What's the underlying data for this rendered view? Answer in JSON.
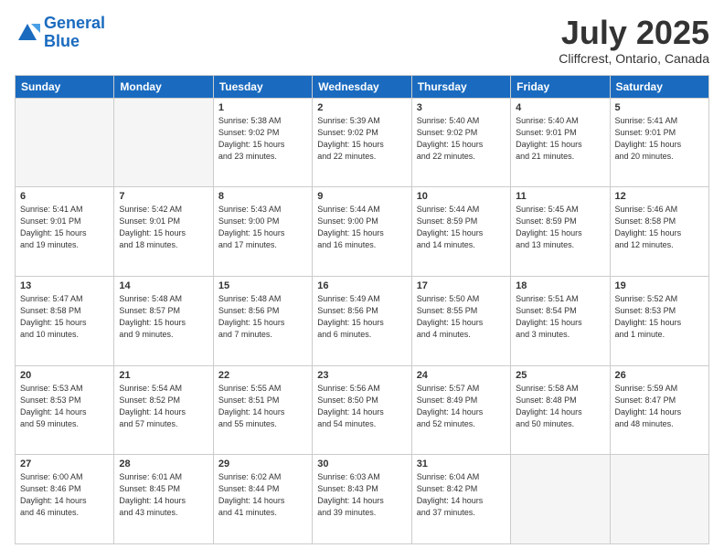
{
  "header": {
    "logo_line1": "General",
    "logo_line2": "Blue",
    "month": "July 2025",
    "location": "Cliffcrest, Ontario, Canada"
  },
  "weekdays": [
    "Sunday",
    "Monday",
    "Tuesday",
    "Wednesday",
    "Thursday",
    "Friday",
    "Saturday"
  ],
  "weeks": [
    [
      {
        "day": "",
        "info": ""
      },
      {
        "day": "",
        "info": ""
      },
      {
        "day": "1",
        "info": "Sunrise: 5:38 AM\nSunset: 9:02 PM\nDaylight: 15 hours\nand 23 minutes."
      },
      {
        "day": "2",
        "info": "Sunrise: 5:39 AM\nSunset: 9:02 PM\nDaylight: 15 hours\nand 22 minutes."
      },
      {
        "day": "3",
        "info": "Sunrise: 5:40 AM\nSunset: 9:02 PM\nDaylight: 15 hours\nand 22 minutes."
      },
      {
        "day": "4",
        "info": "Sunrise: 5:40 AM\nSunset: 9:01 PM\nDaylight: 15 hours\nand 21 minutes."
      },
      {
        "day": "5",
        "info": "Sunrise: 5:41 AM\nSunset: 9:01 PM\nDaylight: 15 hours\nand 20 minutes."
      }
    ],
    [
      {
        "day": "6",
        "info": "Sunrise: 5:41 AM\nSunset: 9:01 PM\nDaylight: 15 hours\nand 19 minutes."
      },
      {
        "day": "7",
        "info": "Sunrise: 5:42 AM\nSunset: 9:01 PM\nDaylight: 15 hours\nand 18 minutes."
      },
      {
        "day": "8",
        "info": "Sunrise: 5:43 AM\nSunset: 9:00 PM\nDaylight: 15 hours\nand 17 minutes."
      },
      {
        "day": "9",
        "info": "Sunrise: 5:44 AM\nSunset: 9:00 PM\nDaylight: 15 hours\nand 16 minutes."
      },
      {
        "day": "10",
        "info": "Sunrise: 5:44 AM\nSunset: 8:59 PM\nDaylight: 15 hours\nand 14 minutes."
      },
      {
        "day": "11",
        "info": "Sunrise: 5:45 AM\nSunset: 8:59 PM\nDaylight: 15 hours\nand 13 minutes."
      },
      {
        "day": "12",
        "info": "Sunrise: 5:46 AM\nSunset: 8:58 PM\nDaylight: 15 hours\nand 12 minutes."
      }
    ],
    [
      {
        "day": "13",
        "info": "Sunrise: 5:47 AM\nSunset: 8:58 PM\nDaylight: 15 hours\nand 10 minutes."
      },
      {
        "day": "14",
        "info": "Sunrise: 5:48 AM\nSunset: 8:57 PM\nDaylight: 15 hours\nand 9 minutes."
      },
      {
        "day": "15",
        "info": "Sunrise: 5:48 AM\nSunset: 8:56 PM\nDaylight: 15 hours\nand 7 minutes."
      },
      {
        "day": "16",
        "info": "Sunrise: 5:49 AM\nSunset: 8:56 PM\nDaylight: 15 hours\nand 6 minutes."
      },
      {
        "day": "17",
        "info": "Sunrise: 5:50 AM\nSunset: 8:55 PM\nDaylight: 15 hours\nand 4 minutes."
      },
      {
        "day": "18",
        "info": "Sunrise: 5:51 AM\nSunset: 8:54 PM\nDaylight: 15 hours\nand 3 minutes."
      },
      {
        "day": "19",
        "info": "Sunrise: 5:52 AM\nSunset: 8:53 PM\nDaylight: 15 hours\nand 1 minute."
      }
    ],
    [
      {
        "day": "20",
        "info": "Sunrise: 5:53 AM\nSunset: 8:53 PM\nDaylight: 14 hours\nand 59 minutes."
      },
      {
        "day": "21",
        "info": "Sunrise: 5:54 AM\nSunset: 8:52 PM\nDaylight: 14 hours\nand 57 minutes."
      },
      {
        "day": "22",
        "info": "Sunrise: 5:55 AM\nSunset: 8:51 PM\nDaylight: 14 hours\nand 55 minutes."
      },
      {
        "day": "23",
        "info": "Sunrise: 5:56 AM\nSunset: 8:50 PM\nDaylight: 14 hours\nand 54 minutes."
      },
      {
        "day": "24",
        "info": "Sunrise: 5:57 AM\nSunset: 8:49 PM\nDaylight: 14 hours\nand 52 minutes."
      },
      {
        "day": "25",
        "info": "Sunrise: 5:58 AM\nSunset: 8:48 PM\nDaylight: 14 hours\nand 50 minutes."
      },
      {
        "day": "26",
        "info": "Sunrise: 5:59 AM\nSunset: 8:47 PM\nDaylight: 14 hours\nand 48 minutes."
      }
    ],
    [
      {
        "day": "27",
        "info": "Sunrise: 6:00 AM\nSunset: 8:46 PM\nDaylight: 14 hours\nand 46 minutes."
      },
      {
        "day": "28",
        "info": "Sunrise: 6:01 AM\nSunset: 8:45 PM\nDaylight: 14 hours\nand 43 minutes."
      },
      {
        "day": "29",
        "info": "Sunrise: 6:02 AM\nSunset: 8:44 PM\nDaylight: 14 hours\nand 41 minutes."
      },
      {
        "day": "30",
        "info": "Sunrise: 6:03 AM\nSunset: 8:43 PM\nDaylight: 14 hours\nand 39 minutes."
      },
      {
        "day": "31",
        "info": "Sunrise: 6:04 AM\nSunset: 8:42 PM\nDaylight: 14 hours\nand 37 minutes."
      },
      {
        "day": "",
        "info": ""
      },
      {
        "day": "",
        "info": ""
      }
    ]
  ]
}
